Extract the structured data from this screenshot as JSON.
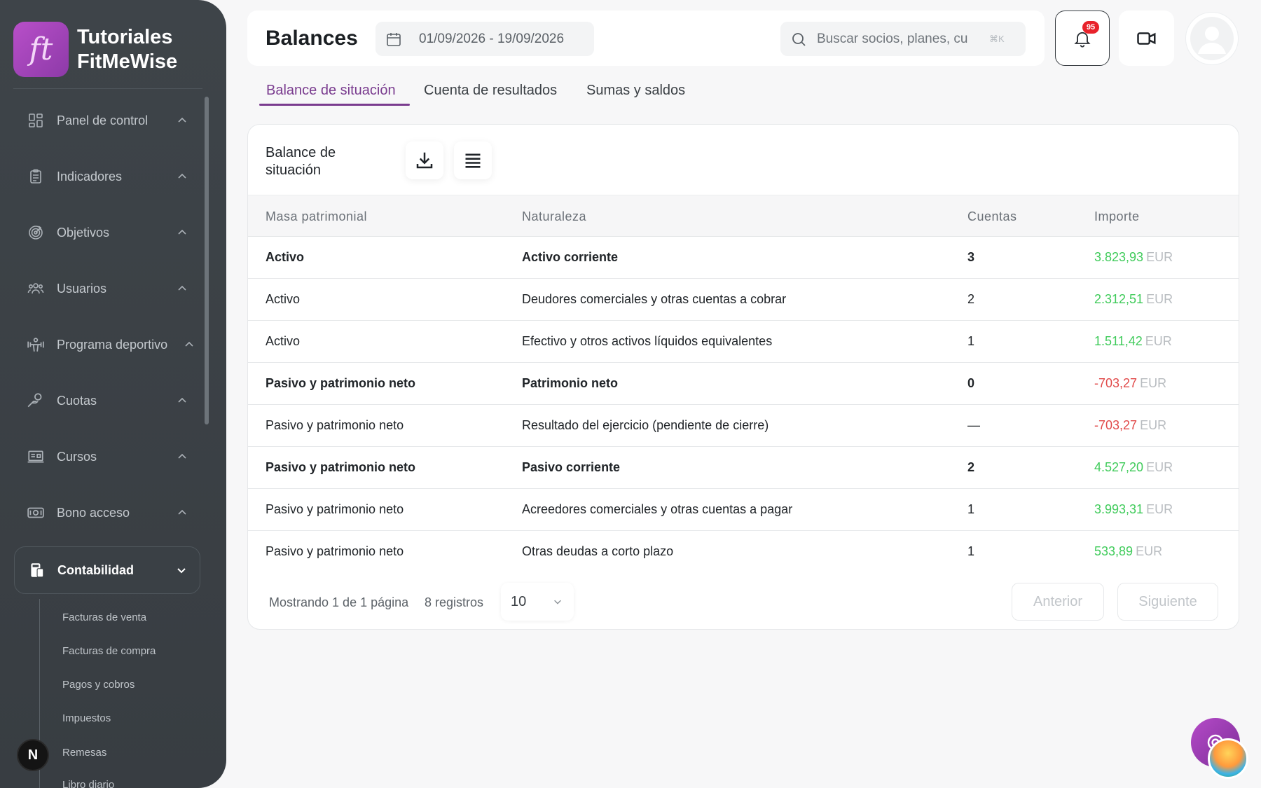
{
  "brand": {
    "logo_text": "ft",
    "name": "Tutoriales\nFitMeWise"
  },
  "sidebar": {
    "items": [
      {
        "label": "Panel de control",
        "icon": "dashboard-icon"
      },
      {
        "label": "Indicadores",
        "icon": "clipboard-icon"
      },
      {
        "label": "Objetivos",
        "icon": "target-icon"
      },
      {
        "label": "Usuarios",
        "icon": "users-icon"
      },
      {
        "label": "Programa deportivo",
        "icon": "weightlifter-icon"
      },
      {
        "label": "Cuotas",
        "icon": "hand-coin-icon"
      },
      {
        "label": "Cursos",
        "icon": "course-icon"
      },
      {
        "label": "Bono acceso",
        "icon": "ticket-money-icon"
      },
      {
        "label": "Contabilidad",
        "icon": "accounting-icon",
        "active": true
      }
    ],
    "subitems": [
      "Facturas de venta",
      "Facturas de compra",
      "Pagos y cobros",
      "Impuestos",
      "Remesas",
      "Libro diario"
    ],
    "bottom_avatar": "N"
  },
  "header": {
    "title": "Balances",
    "date_range": "01/09/2026 - 19/09/2026",
    "search_placeholder": "Buscar socios, planes, cu",
    "search_shortcut": "⌘K",
    "notifications_count": "95"
  },
  "tabs": [
    {
      "label": "Balance de situación",
      "active": true
    },
    {
      "label": "Cuenta de resultados",
      "active": false
    },
    {
      "label": "Sumas y saldos",
      "active": false
    }
  ],
  "card": {
    "title": "Balance de situación",
    "columns": [
      "Masa patrimonial",
      "Naturaleza",
      "Cuentas",
      "Importe"
    ],
    "rows": [
      {
        "masa": "Activo",
        "naturaleza": "Activo corriente",
        "cuentas": "3",
        "importe": "3.823,93",
        "moneda": "EUR",
        "bold": true,
        "sign": "pos"
      },
      {
        "masa": "Activo",
        "naturaleza": "Deudores comerciales y otras cuentas a cobrar",
        "cuentas": "2",
        "importe": "2.312,51",
        "moneda": "EUR",
        "bold": false,
        "sign": "pos"
      },
      {
        "masa": "Activo",
        "naturaleza": "Efectivo y otros activos líquidos equivalentes",
        "cuentas": "1",
        "importe": "1.511,42",
        "moneda": "EUR",
        "bold": false,
        "sign": "pos"
      },
      {
        "masa": "Pasivo y patrimonio neto",
        "naturaleza": "Patrimonio neto",
        "cuentas": "0",
        "importe": "-703,27",
        "moneda": "EUR",
        "bold": true,
        "sign": "neg"
      },
      {
        "masa": "Pasivo y patrimonio neto",
        "naturaleza": "Resultado del ejercicio (pendiente de cierre)",
        "cuentas": "—",
        "importe": "-703,27",
        "moneda": "EUR",
        "bold": false,
        "sign": "neg"
      },
      {
        "masa": "Pasivo y patrimonio neto",
        "naturaleza": "Pasivo corriente",
        "cuentas": "2",
        "importe": "4.527,20",
        "moneda": "EUR",
        "bold": true,
        "sign": "pos"
      },
      {
        "masa": "Pasivo y patrimonio neto",
        "naturaleza": "Acreedores comerciales y otras cuentas a pagar",
        "cuentas": "1",
        "importe": "3.993,31",
        "moneda": "EUR",
        "bold": false,
        "sign": "pos"
      },
      {
        "masa": "Pasivo y patrimonio neto",
        "naturaleza": "Otras deudas a corto plazo",
        "cuentas": "1",
        "importe": "533,89",
        "moneda": "EUR",
        "bold": false,
        "sign": "pos"
      }
    ],
    "footer": {
      "page_info": "Mostrando 1 de 1 página",
      "records": "8 registros",
      "page_size": "10",
      "prev_label": "Anterior",
      "next_label": "Siguiente"
    }
  },
  "colors": {
    "accent": "#7a3c8f",
    "positive": "#3fcb5a",
    "negative": "#e14a4a",
    "sidebar_bg": "#3e4449"
  }
}
